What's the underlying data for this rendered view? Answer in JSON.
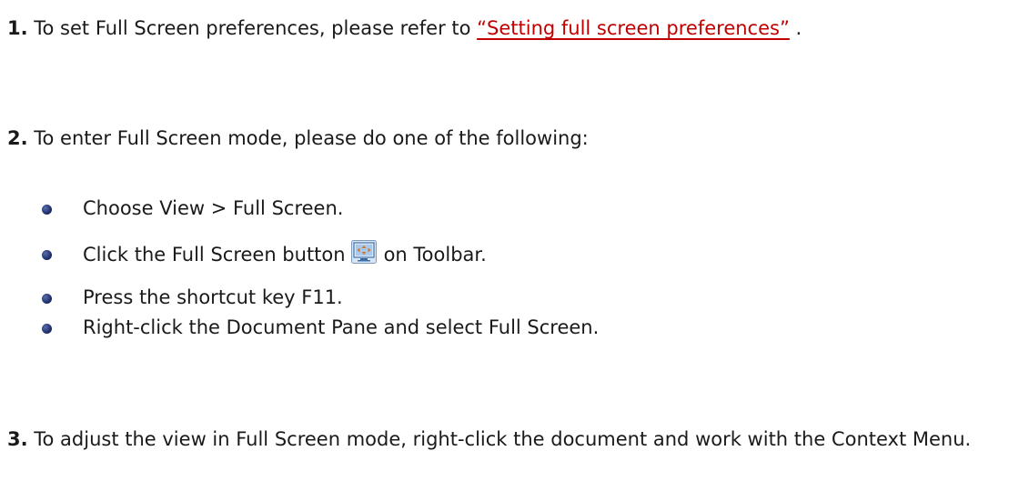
{
  "steps": [
    {
      "number": "1.",
      "text_before": " To set Full Screen preferences, please refer to ",
      "link_text": "“Setting full screen preferences”",
      "text_after": " ."
    },
    {
      "number": "2.",
      "text": " To enter Full Screen mode, please do one of the following:"
    },
    {
      "number": "3.",
      "text": " To adjust the view in Full Screen mode, right-click the document and work with the Context Menu."
    }
  ],
  "bullets": [
    {
      "text": "Choose View > Full Screen."
    },
    {
      "text_before": "Click the Full Screen button",
      "icon": "full-screen-button-icon",
      "text_after": "on Toolbar."
    },
    {
      "text": "Press the shortcut key F11."
    },
    {
      "text": "Right-click the Document Pane and select Full Screen."
    }
  ],
  "colors": {
    "text": "#1a1a1a",
    "link": "#c00000",
    "bullet": "#1f2f6a"
  }
}
